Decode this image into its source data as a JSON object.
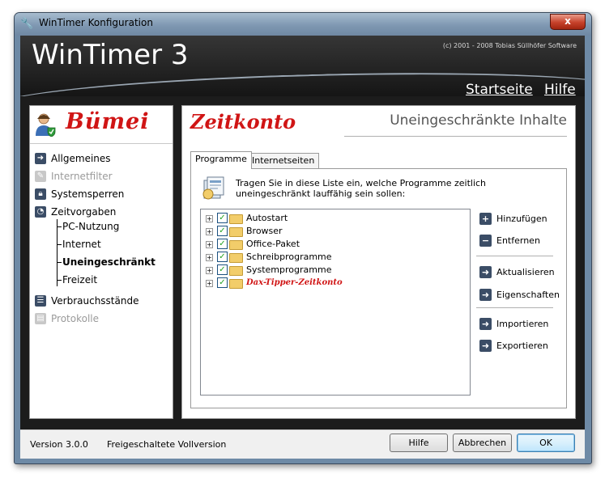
{
  "window": {
    "title": "WinTimer Konfiguration",
    "close_label": "x",
    "app_icon": "wrench-icon"
  },
  "banner": {
    "title": "WinTimer 3",
    "copyright": "(c) 2001 - 2008 Tobias Süllhöfer Software",
    "links": {
      "home": "Startseite",
      "help": "Hilfe"
    }
  },
  "sidebar": {
    "logo_text": "Bümei",
    "items": [
      {
        "label": "Allgemeines",
        "icon": "arrow-right-icon",
        "enabled": true
      },
      {
        "label": "Internetfilter",
        "icon": "pencil-icon",
        "enabled": false
      },
      {
        "label": "Systemsperren",
        "icon": "lock-icon",
        "enabled": true
      },
      {
        "label": "Zeitvorgaben",
        "icon": "clock-icon",
        "enabled": true
      },
      {
        "label": "Verbrauchsstände",
        "icon": "list-icon",
        "enabled": true
      },
      {
        "label": "Protokolle",
        "icon": "clipboard-icon",
        "enabled": false
      }
    ],
    "subitems": [
      {
        "label": "PC-Nutzung",
        "selected": false
      },
      {
        "label": "Internet",
        "selected": false
      },
      {
        "label": "Uneingeschränkt",
        "selected": true
      },
      {
        "label": "Freizeit",
        "selected": false
      }
    ]
  },
  "main": {
    "brand": "Zeitkonto",
    "section_title": "Uneingeschränkte Inhalte",
    "tabs": [
      {
        "label": "Programme",
        "active": true
      },
      {
        "label": "Internetseiten",
        "active": false
      }
    ],
    "intro": "Tragen Sie in diese Liste ein, welche Programme zeitlich uneingeschränkt lauffähig sein sollen:",
    "list_items": [
      {
        "label": "Autostart",
        "checked": true,
        "special": false
      },
      {
        "label": "Browser",
        "checked": true,
        "special": false
      },
      {
        "label": "Office-Paket",
        "checked": true,
        "special": false
      },
      {
        "label": "Schreibprogramme",
        "checked": true,
        "special": false
      },
      {
        "label": "Systemprogramme",
        "checked": true,
        "special": false
      },
      {
        "label": "Dax-Tipper-Zeitkonto",
        "checked": true,
        "special": true
      }
    ],
    "actions": [
      {
        "label": "Hinzufügen",
        "icon": "plus-icon"
      },
      {
        "label": "Entfernen",
        "icon": "minus-icon"
      },
      {
        "label": "Aktualisieren",
        "icon": "arrow-right-icon"
      },
      {
        "label": "Eigenschaften",
        "icon": "arrow-right-icon"
      },
      {
        "label": "Importieren",
        "icon": "arrow-right-icon"
      },
      {
        "label": "Exportieren",
        "icon": "arrow-right-icon"
      }
    ]
  },
  "footer": {
    "version": "Version 3.0.0",
    "license": "Freigeschaltete Vollversion",
    "buttons": {
      "help": "Hilfe",
      "cancel": "Abbrechen",
      "ok": "OK"
    }
  }
}
